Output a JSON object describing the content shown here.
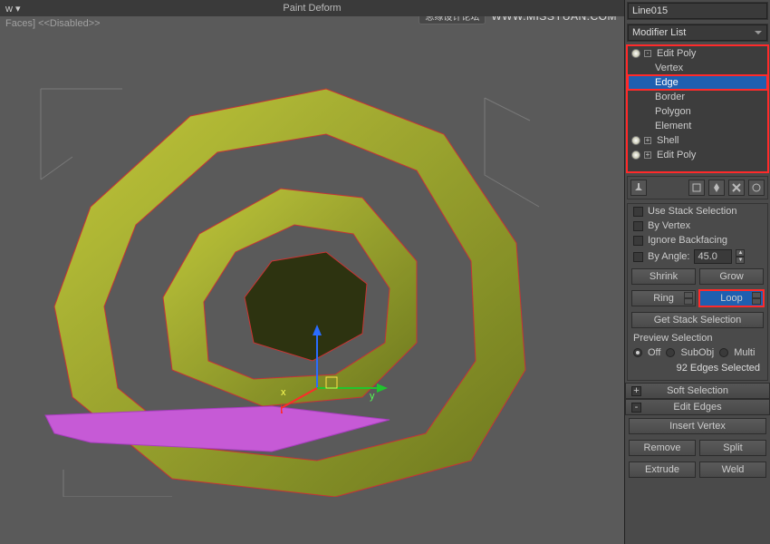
{
  "header": {
    "title": "Paint Deform",
    "viewLabel": "w ▾",
    "status": "Faces]  <<Disabled>>"
  },
  "watermark": {
    "tag": "思缘设计论坛",
    "url": "WWW.MISSYUAN.COM"
  },
  "object": {
    "name": "Line015",
    "modifier_list_label": "Modifier List"
  },
  "modstack": {
    "items": [
      {
        "label": "Edit Poly",
        "expandable": true,
        "bulb": true
      },
      {
        "label": "Vertex",
        "sub": true
      },
      {
        "label": "Edge",
        "sub": true,
        "selected": true
      },
      {
        "label": "Border",
        "sub": true
      },
      {
        "label": "Polygon",
        "sub": true
      },
      {
        "label": "Element",
        "sub": true
      },
      {
        "label": "Shell",
        "expandable": true,
        "bulb": true
      },
      {
        "label": "Edit Poly",
        "expandable": true,
        "bulb": true
      }
    ]
  },
  "selection": {
    "use_stack": "Use Stack Selection",
    "by_vertex": "By Vertex",
    "ignore_backfacing": "Ignore Backfacing",
    "by_angle": "By Angle:",
    "angle_value": "45.0",
    "shrink": "Shrink",
    "grow": "Grow",
    "ring": "Ring",
    "loop": "Loop",
    "get_stack": "Get Stack Selection",
    "preview_label": "Preview Selection",
    "preview_off": "Off",
    "preview_subobj": "SubObj",
    "preview_multi": "Multi",
    "status": "92 Edges Selected"
  },
  "rollouts": {
    "soft_selection": "Soft Selection",
    "edit_edges": "Edit Edges",
    "insert_vertex": "Insert Vertex",
    "remove": "Remove",
    "split": "Split",
    "extrude": "Extrude",
    "weld": "Weld"
  },
  "gizmo": {
    "x": "x",
    "y": "y",
    "z": ""
  }
}
